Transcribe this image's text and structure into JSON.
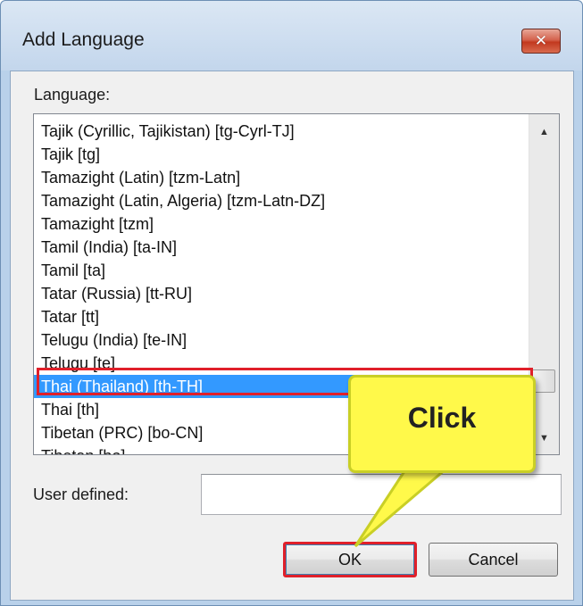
{
  "window": {
    "title": "Add Language",
    "close_icon": "close-icon"
  },
  "language_label": "Language:",
  "language_list": {
    "items": [
      "Tajik (Cyrillic, Tajikistan) [tg-Cyrl-TJ]",
      "Tajik [tg]",
      "Tamazight (Latin) [tzm-Latn]",
      "Tamazight (Latin, Algeria) [tzm-Latn-DZ]",
      "Tamazight [tzm]",
      "Tamil (India) [ta-IN]",
      "Tamil [ta]",
      "Tatar (Russia) [tt-RU]",
      "Tatar [tt]",
      "Telugu (India) [te-IN]",
      "Telugu [te]",
      "Thai (Thailand) [th-TH]",
      "Thai [th]",
      "Tibetan (PRC) [bo-CN]",
      "Tibetan [bo]"
    ],
    "selected": "Thai (Thailand) [th-TH]"
  },
  "user_defined": {
    "label": "User defined:",
    "value": ""
  },
  "buttons": {
    "ok": "OK",
    "cancel": "Cancel"
  },
  "annotation": {
    "callout_text": "Click",
    "highlight_color": "#e0202a",
    "callout_color": "#fff94a"
  },
  "colors": {
    "selection": "#3399ff",
    "title_bar": "#c3d6ec"
  }
}
